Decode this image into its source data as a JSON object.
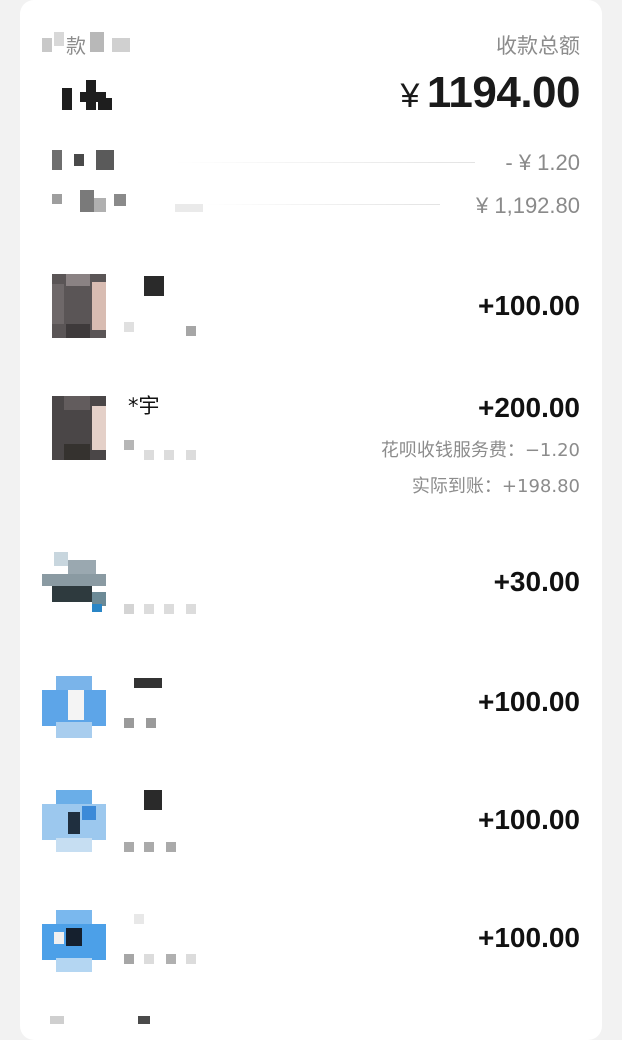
{
  "header": {
    "title": "收款总额",
    "left_label": "款",
    "total_currency": "¥",
    "total_value": "1194.00"
  },
  "summary": {
    "fee": "- ¥ 1.20",
    "net": "¥ 1,192.80"
  },
  "transactions": [
    {
      "name": "",
      "amount": "+100.00"
    },
    {
      "name": "*宇",
      "amount": "+200.00",
      "fee_line": "花呗收钱服务费：−1.20",
      "net_line": "实际到账：+198.80"
    },
    {
      "name": "",
      "amount": "+30.00"
    },
    {
      "name": "",
      "amount": "+100.00"
    },
    {
      "name": "",
      "amount": "+100.00"
    },
    {
      "name": "",
      "amount": "+100.00"
    }
  ]
}
